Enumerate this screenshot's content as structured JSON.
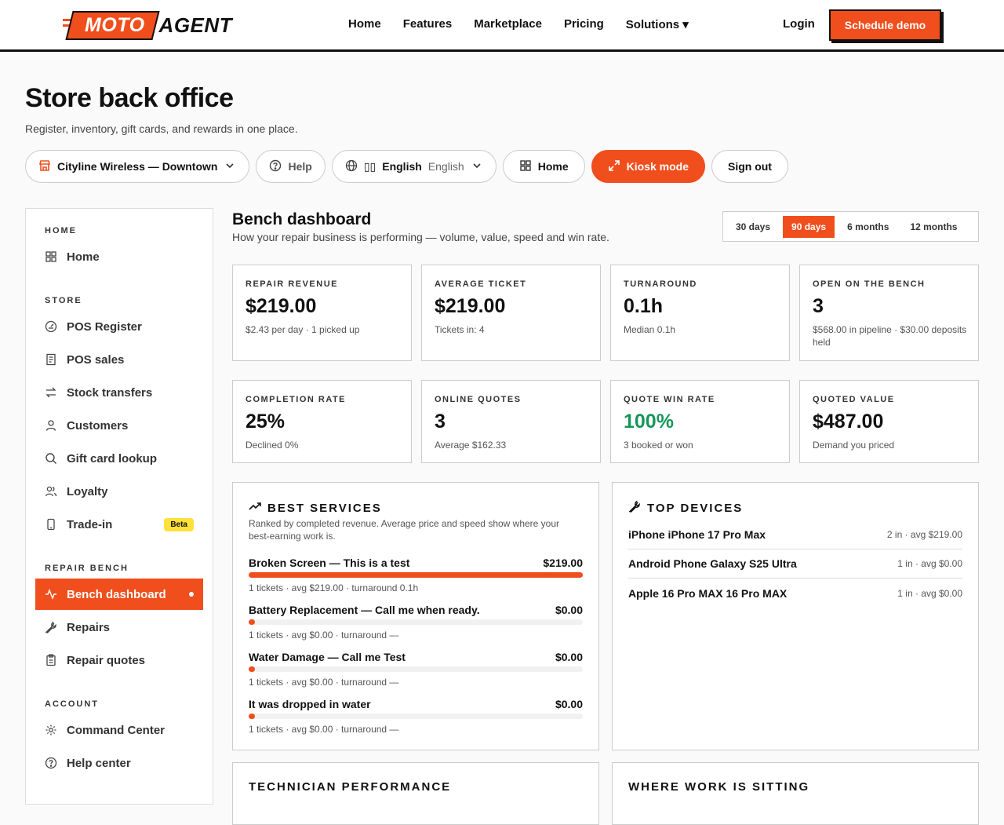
{
  "nav": {
    "logo_moto": "MOTO",
    "logo_agent": "AGENT",
    "links": [
      "Home",
      "Features",
      "Marketplace",
      "Pricing",
      "Solutions ▾"
    ],
    "login": "Login",
    "demo": "Schedule demo"
  },
  "page": {
    "title": "Store back office",
    "subtitle": "Register, inventory, gift cards, and rewards in one place."
  },
  "toolbar": {
    "store": "Cityline Wireless — Downtown",
    "help": "Help",
    "lang_flag": "▯▯",
    "lang": "English",
    "lang_muted": "English",
    "home": "Home",
    "kiosk": "Kiosk mode",
    "signout": "Sign out"
  },
  "sidebar": {
    "sections": {
      "home": "HOME",
      "store": "STORE",
      "repair": "REPAIR BENCH",
      "account": "ACCOUNT"
    },
    "items": {
      "home": "Home",
      "pos_register": "POS Register",
      "pos_sales": "POS sales",
      "stock_transfers": "Stock transfers",
      "customers": "Customers",
      "gift_card": "Gift card lookup",
      "loyalty": "Loyalty",
      "trade_in": "Trade-in",
      "trade_in_badge": "Beta",
      "bench_dashboard": "Bench dashboard",
      "repairs": "Repairs",
      "repair_quotes": "Repair quotes",
      "command_center": "Command Center",
      "help_center": "Help center"
    }
  },
  "dashboard": {
    "title": "Bench dashboard",
    "subtitle": "How your repair business is performing — volume, value, speed and win rate.",
    "ranges": [
      "30 days",
      "90 days",
      "6 months",
      "12 months"
    ],
    "active_range": "90 days",
    "kpis": [
      {
        "label": "REPAIR REVENUE",
        "value": "$219.00",
        "sub": "$2.43 per day · 1 picked up"
      },
      {
        "label": "AVERAGE TICKET",
        "value": "$219.00",
        "sub": "Tickets in: 4"
      },
      {
        "label": "TURNAROUND",
        "value": "0.1h",
        "sub": "Median 0.1h"
      },
      {
        "label": "OPEN ON THE BENCH",
        "value": "3",
        "sub": "$568.00 in pipeline · $30.00 deposits held"
      },
      {
        "label": "COMPLETION RATE",
        "value": "25%",
        "sub": "Declined 0%"
      },
      {
        "label": "ONLINE QUOTES",
        "value": "3",
        "sub": "Average $162.33"
      },
      {
        "label": "QUOTE WIN RATE",
        "value": "100%",
        "sub": "3 booked or won"
      },
      {
        "label": "QUOTED VALUE",
        "value": "$487.00",
        "sub": "Demand you priced"
      }
    ],
    "best_services": {
      "title": "BEST SERVICES",
      "subtitle": "Ranked by completed revenue. Average price and speed show where your best-earning work is.",
      "items": [
        {
          "name": "Broken Screen — This is a test",
          "value": "$219.00",
          "share": 1.0,
          "meta": "1 tickets · avg $219.00 · turnaround 0.1h"
        },
        {
          "name": "Battery Replacement — Call me when ready.",
          "value": "$0.00",
          "share": 0.0,
          "meta": "1 tickets · avg $0.00 · turnaround —"
        },
        {
          "name": "Water Damage — Call me Test",
          "value": "$0.00",
          "share": 0.0,
          "meta": "1 tickets · avg $0.00 · turnaround —"
        },
        {
          "name": "It was dropped in water",
          "value": "$0.00",
          "share": 0.0,
          "meta": "1 tickets · avg $0.00 · turnaround —"
        }
      ]
    },
    "top_devices": {
      "title": "TOP DEVICES",
      "items": [
        {
          "name": "iPhone iPhone 17 Pro Max",
          "count": "2 in · avg $219.00"
        },
        {
          "name": "Android Phone Galaxy S25 Ultra",
          "count": "1 in · avg $0.00"
        },
        {
          "name": "Apple 16 Pro MAX 16 Pro MAX",
          "count": "1 in · avg $0.00"
        }
      ]
    },
    "technician_title": "TECHNICIAN PERFORMANCE",
    "where_title": "WHERE WORK IS SITTING"
  },
  "colors": {
    "accent": "#f04e1c",
    "green": "#18965a",
    "beta": "#ffe13a"
  }
}
